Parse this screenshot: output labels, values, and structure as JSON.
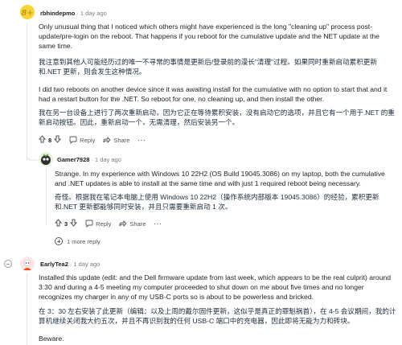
{
  "comments": [
    {
      "username": "rbhindepmo",
      "time": "1 day ago",
      "paragraphs": [
        "Only unusual thing that I noticed which others might have experienced is the long \"cleaning up\" process post-update/pre-login on the reboot. That happens if you reboot for the cumulative update and the NET update at the same time.",
        "我注意到其他人可能经历过的唯一不寻常的事情是更新后/登录前的漫长\"清理\"过程。如果同时重新启动累积更新和.NET 更新，则会发生这种情况。",
        "I did two reboots on another device since it was awaiting install for the cumulative with no option to start that and it had a restart button for the .NET. So reboot for one, no cleaning up, and then install the other.",
        "我在另一台设备上进行了两次重新启动，因为它正在等待累积安装，没有启动它的选项，并且它有一个用于.NET 的重新启动按钮。因此，重新启动一个，无需清理，然后安装另一个。"
      ],
      "score": "8",
      "reply": "Reply",
      "share": "Share",
      "more": "···"
    },
    {
      "username": "Gamer7928",
      "time": "1 day ago",
      "paragraphs": [
        "Strange. In my experience with Windows 10 22H2 (OS Build 19045.3086) on my laptop, both the cumulative and .NET updates is able to install at the same time and with just 1 required reboot being necessary.",
        "奇怪。根据我在笔记本电脑上使用 Windows 10 22H2（操作系统内部版本 19045.3086）的经验，累积更新和.NET 更新都能够同时安装，并且只需要重新启动 1 次。"
      ],
      "score": "3",
      "reply": "Reply",
      "share": "Share",
      "more": "···",
      "more_reply": "1 more reply"
    },
    {
      "username": "EarlyTea2",
      "time": "1 day ago",
      "paragraphs": [
        "Installed this update (edit: and the Dell firmware update from last week, which appears to be the real culprit) around 3:30 and during a 4-5 meeting my computer proceeded to shut down on me about five times and no longer recognizes my charger in any of my USB-C ports so is about to be powerless and bricked.",
        "在 3：30 左右安装了此更新（编辑：以及上周的戴尔固件更新，这似乎是真正的罪魁祸首），在 4-5 会议期间，我的计算机继续关闭我大约五次，并且不再识别我的任何 USB-C 端口中的充电器，因此即将无能为力和砖块。",
        "Beware."
      ]
    }
  ],
  "colors": {
    "avatar1": "#f5d53a",
    "avatar1_text": "#c79a14",
    "avatar2_bg": "#e7f3dd",
    "avatar3_bg": "#fde7ea",
    "accent_red": "#ff4500"
  },
  "icons": [
    "upvote-arrow",
    "downvote-arrow",
    "reply-bubble",
    "share-arrow",
    "overflow-dots",
    "expand-plus-circle",
    "collapse-circle"
  ]
}
